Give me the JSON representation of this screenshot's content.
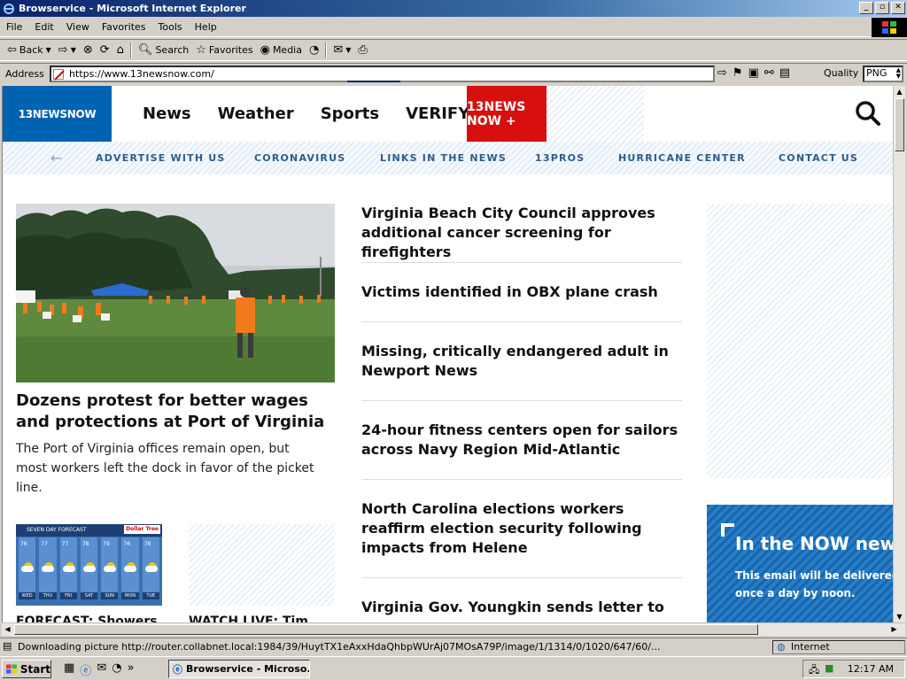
{
  "window": {
    "title": "Browservice - Microsoft Internet Explorer",
    "controls": [
      "_",
      "▫",
      "✕"
    ]
  },
  "menu": [
    "File",
    "Edit",
    "View",
    "Favorites",
    "Tools",
    "Help"
  ],
  "toolbar": {
    "back": "Back",
    "search": "Search",
    "favorites": "Favorites",
    "media": "Media"
  },
  "address": {
    "label": "Address",
    "url": "https://www.13newsnow.com/",
    "quality_label": "Quality",
    "quality_value": "PNG"
  },
  "site": {
    "logo": "13NEWSNOW",
    "nav": [
      "News",
      "Weather",
      "Sports",
      "VERIFY"
    ],
    "plus_label": "13NEWS NOW +",
    "subnav": [
      "ADVERTISE WITH US",
      "CORONAVIRUS",
      "LINKS IN THE NEWS",
      "13PROS",
      "HURRICANE CENTER",
      "CONTACT US"
    ],
    "hero": {
      "title": "Dozens protest for better wages and protections at Port of Virginia",
      "desc": "The Port of Virginia offices remain open, but most workers left the dock in favor of the picket line."
    },
    "stories": [
      "Virginia Beach City Council approves additional cancer screening for firefighters",
      "Victims identified in OBX plane crash",
      "Missing, critically endangered adult in Newport News",
      "24-hour fitness centers open for sailors across Navy Region Mid-Atlantic",
      "North Carolina elections workers reaffirm election security following impacts from Helene",
      "Virginia Gov. Youngkin sends letter to"
    ],
    "thumbs": [
      {
        "caption": "FORECAST: Showers",
        "header": "SEVEN DAY FORECAST",
        "brand": "Dollar Tree"
      },
      {
        "caption": "WATCH LIVE: Tim"
      }
    ],
    "forecast_days": [
      {
        "day": "WED",
        "temp": "76"
      },
      {
        "day": "THU",
        "temp": "77"
      },
      {
        "day": "FRI",
        "temp": "77"
      },
      {
        "day": "SAT",
        "temp": "78"
      },
      {
        "day": "SUN",
        "temp": "79"
      },
      {
        "day": "MON",
        "temp": "76"
      },
      {
        "day": "TUE",
        "temp": "78"
      }
    ],
    "newsletter": {
      "title": "In the NOW news",
      "desc": "This email will be delivered once a day by noon."
    }
  },
  "status": {
    "text": "Downloading picture http://router.collabnet.local:1984/39/HuytTX1eAxxHdaQhbpWUrAj07MOsA79P/image/1/1314/0/1020/647/60/...",
    "zone": "Internet"
  },
  "taskbar": {
    "start": "Start",
    "task": "Browservice - Microso...",
    "clock": "12:17 AM"
  }
}
